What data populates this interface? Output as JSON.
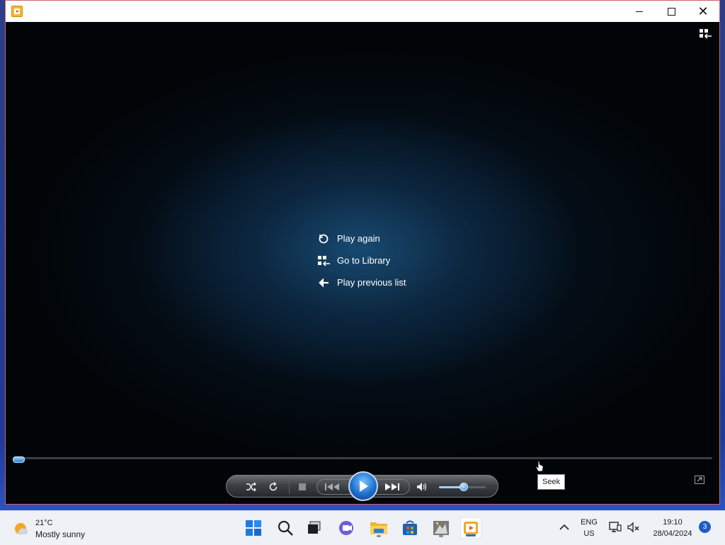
{
  "window": {
    "app_icon": "media-player-icon",
    "controls": {
      "minimize": "minimize-icon",
      "maximize": "maximize-icon",
      "close": "close-icon"
    }
  },
  "player": {
    "menu": [
      {
        "label": "Play again",
        "icon": "replay-icon"
      },
      {
        "label": "Go to Library",
        "icon": "library-icon"
      },
      {
        "label": "Play previous list",
        "icon": "back-arrow-icon"
      }
    ],
    "seek_tooltip": "Seek",
    "seek_position": 0.0,
    "volume_level": 0.5,
    "accent_color": "#2f7fd6"
  },
  "taskbar": {
    "weather": {
      "temperature": "21°C",
      "condition": "Mostly sunny"
    },
    "pinned": [
      {
        "name": "start",
        "icon": "windows-start-icon"
      },
      {
        "name": "search",
        "icon": "search-icon"
      },
      {
        "name": "task-view",
        "icon": "task-view-icon"
      },
      {
        "name": "meet",
        "icon": "video-call-icon"
      },
      {
        "name": "file-explorer",
        "icon": "folder-icon"
      },
      {
        "name": "store",
        "icon": "store-icon"
      },
      {
        "name": "app",
        "icon": "app-icon"
      },
      {
        "name": "media-player",
        "icon": "media-player-icon"
      }
    ],
    "tray": {
      "language_top": "ENG",
      "language_bottom": "US",
      "time": "19:10",
      "date": "28/04/2024",
      "notifications": "3"
    }
  }
}
